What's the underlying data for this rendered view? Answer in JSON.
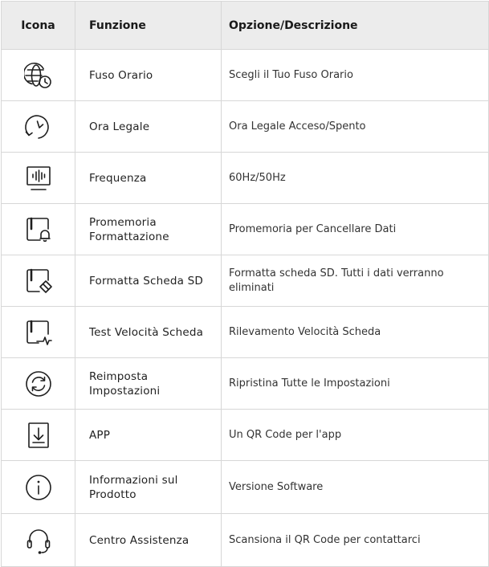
{
  "header": {
    "icon": "Icona",
    "function": "Funzione",
    "description": "Opzione/Descrizione"
  },
  "rows": [
    {
      "icon": "globe-clock-icon",
      "function": "Fuso Orario",
      "description": "Scegli il Tuo Fuso Orario"
    },
    {
      "icon": "clock-icon",
      "function": "Ora Legale",
      "description": "Ora Legale  Acceso/Spento"
    },
    {
      "icon": "monitor-frequency-icon",
      "function": "Frequenza",
      "description": "60Hz/50Hz"
    },
    {
      "icon": "sd-card-bell-icon",
      "function": "Promemoria Formattazione",
      "description": "Promemoria per Cancellare Dati"
    },
    {
      "icon": "sd-card-eraser-icon",
      "function": "Formatta Scheda SD",
      "description": "Formatta scheda SD. Tutti i dati verranno eliminati"
    },
    {
      "icon": "sd-card-pulse-icon",
      "function": "Test Velocità Scheda",
      "description": "Rilevamento Velocità Scheda"
    },
    {
      "icon": "reset-icon",
      "function": "Reimposta Impostazioni",
      "description": "Ripristina Tutte le Impostazioni"
    },
    {
      "icon": "download-box-icon",
      "function": "APP",
      "description": "Un QR Code per l'app"
    },
    {
      "icon": "info-icon",
      "function": "Informazioni sul Prodotto",
      "description": "Versione Software"
    },
    {
      "icon": "headset-icon",
      "function": "Centro Assistenza",
      "description": "Scansiona il QR Code per contattarci"
    }
  ]
}
